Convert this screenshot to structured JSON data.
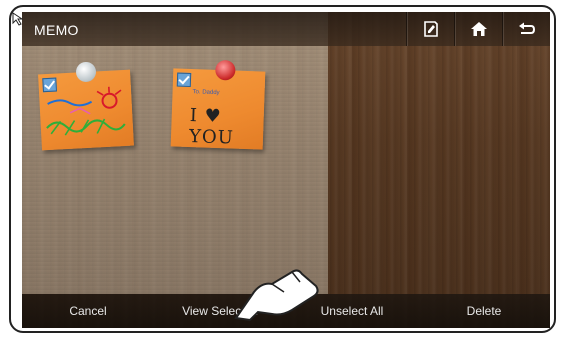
{
  "header": {
    "title": "MEMO"
  },
  "toolbar": {
    "buttons": [
      {
        "name": "memo-edit-icon"
      },
      {
        "name": "home-icon"
      },
      {
        "name": "back-icon"
      }
    ]
  },
  "memos": [
    {
      "selected": true,
      "pin_color": "#c9d2d6"
    },
    {
      "selected": true,
      "pin_color": "#cc2a2a",
      "text": "I ♥ YOU",
      "small": "To. Daddy"
    }
  ],
  "actions": {
    "cancel": "Cancel",
    "view_selected": "View Selected",
    "unselect_all": "Unselect All",
    "delete": "Delete"
  },
  "colors": {
    "memo": "#ee8a2f",
    "wood": "#5a3c25",
    "bar_text": "#e8e8e8"
  }
}
